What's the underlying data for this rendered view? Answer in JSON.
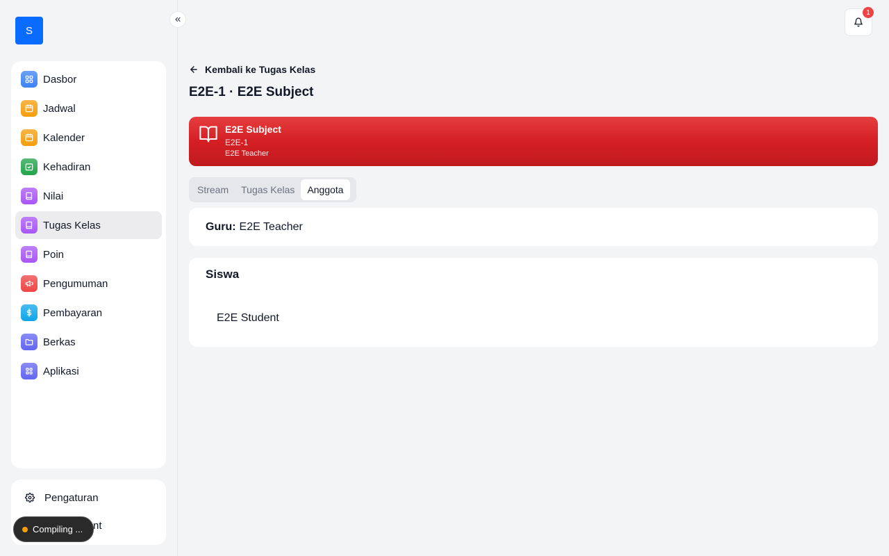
{
  "sidebar": {
    "logo_letter": "S",
    "items": [
      {
        "label": "Dasbor",
        "icon": "dashboard-icon",
        "color": "#3b82f6",
        "active": false
      },
      {
        "label": "Jadwal",
        "icon": "calendar-icon",
        "color": "#f59e0b",
        "active": false
      },
      {
        "label": "Kalender",
        "icon": "calendar-icon",
        "color": "#f59e0b",
        "active": false
      },
      {
        "label": "Kehadiran",
        "icon": "check-calendar-icon",
        "color": "#22a34a",
        "active": false
      },
      {
        "label": "Nilai",
        "icon": "book-icon",
        "color": "#a855f7",
        "active": false
      },
      {
        "label": "Tugas Kelas",
        "icon": "book-icon",
        "color": "#a855f7",
        "active": true
      },
      {
        "label": "Poin",
        "icon": "book-icon",
        "color": "#a855f7",
        "active": false
      },
      {
        "label": "Pengumuman",
        "icon": "megaphone-icon",
        "color": "#ef4444",
        "active": false
      },
      {
        "label": "Pembayaran",
        "icon": "dollar-icon",
        "color": "#0ea5e9",
        "active": false
      },
      {
        "label": "Berkas",
        "icon": "folder-icon",
        "color": "#6366f1",
        "active": false
      },
      {
        "label": "Aplikasi",
        "icon": "apps-icon",
        "color": "#6366f1",
        "active": false
      }
    ],
    "bottom": {
      "settings_label": "Pengaturan",
      "second_label_partial": "nt"
    },
    "toast": "Compiling ..."
  },
  "header": {
    "notification_count": "1"
  },
  "main": {
    "back_label": "Kembali ke Tugas Kelas",
    "title": "E2E-1 · E2E Subject",
    "banner": {
      "subject": "E2E Subject",
      "code": "E2E-1",
      "teacher": "E2E Teacher",
      "color": "#dc2626"
    },
    "tabs": [
      {
        "label": "Stream",
        "active": false
      },
      {
        "label": "Tugas Kelas",
        "active": false
      },
      {
        "label": "Anggota",
        "active": true
      }
    ],
    "teacher_label": "Guru:",
    "teacher_name": "E2E Teacher",
    "students_title": "Siswa",
    "students": [
      "E2E Student"
    ]
  }
}
